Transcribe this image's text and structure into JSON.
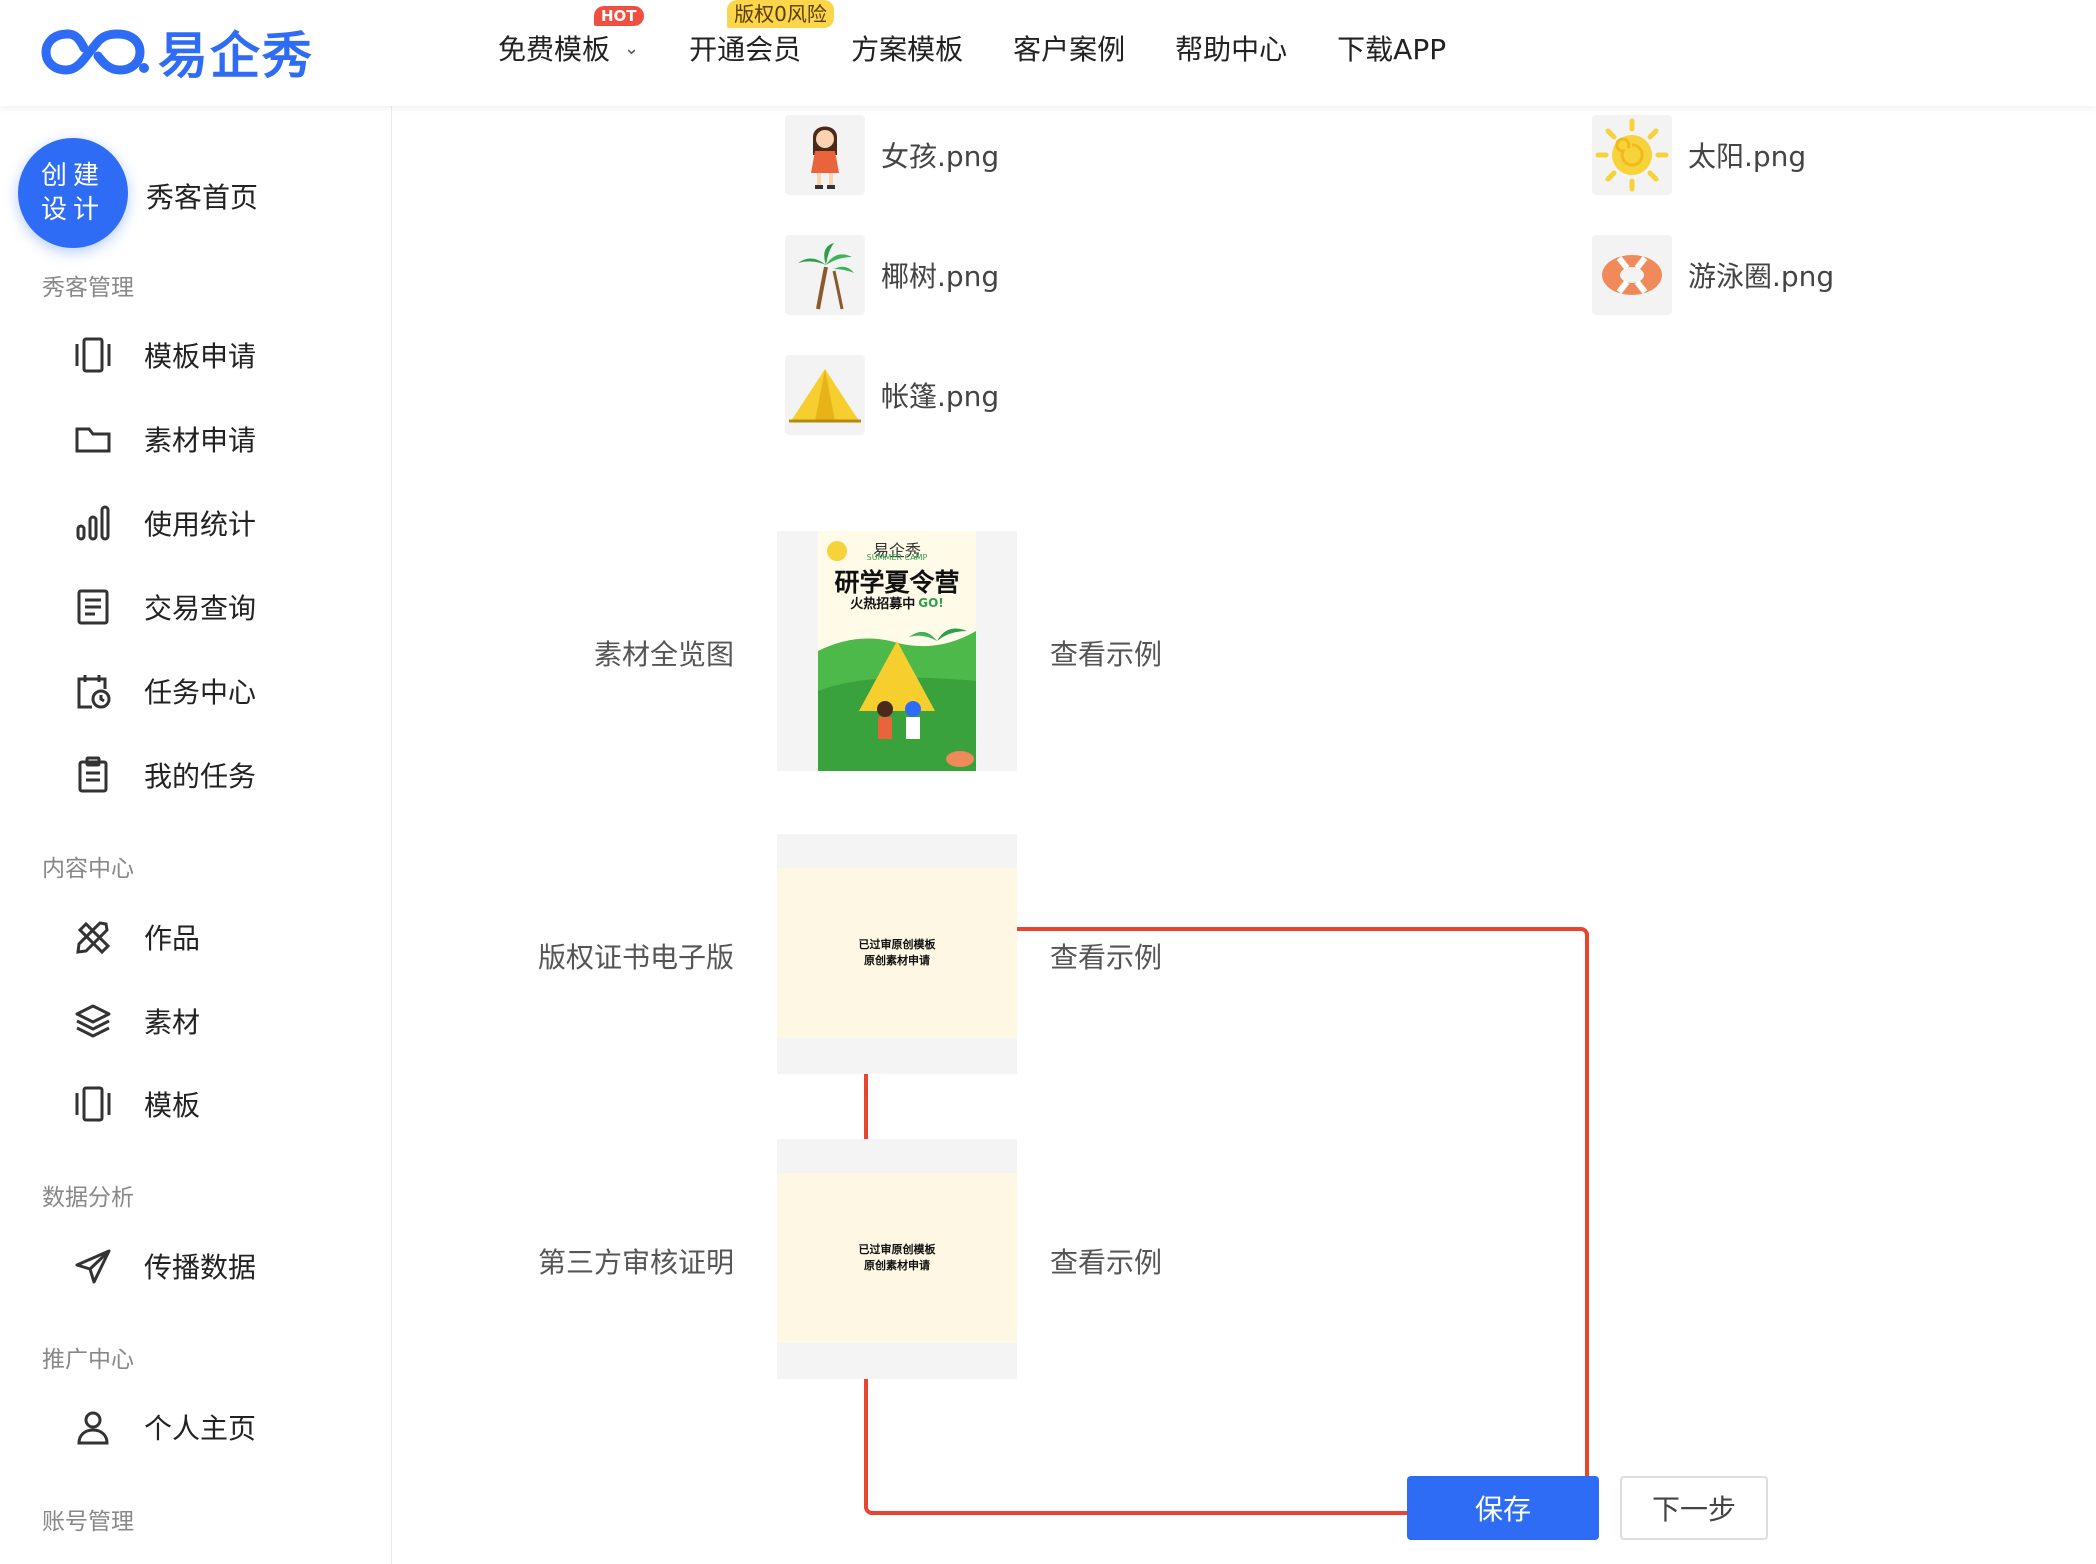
{
  "header": {
    "logo_text": "易企秀",
    "nav": [
      {
        "label": "免费模板",
        "badge": "HOT",
        "has_dropdown": true
      },
      {
        "label": "开通会员",
        "badge": "版权0风险"
      },
      {
        "label": "方案模板"
      },
      {
        "label": "客户案例"
      },
      {
        "label": "帮助中心"
      },
      {
        "label": "下载APP"
      }
    ]
  },
  "sidebar": {
    "create_button": "创建设计",
    "home": "秀客首页",
    "sections": [
      {
        "title": "秀客管理",
        "items": [
          {
            "label": "模板申请",
            "icon": "template-icon"
          },
          {
            "label": "素材申请",
            "icon": "folder-icon"
          },
          {
            "label": "使用统计",
            "icon": "bar-chart-icon"
          },
          {
            "label": "交易查询",
            "icon": "document-list-icon"
          },
          {
            "label": "任务中心",
            "icon": "calendar-clock-icon"
          },
          {
            "label": "我的任务",
            "icon": "clipboard-icon"
          }
        ]
      },
      {
        "title": "内容中心",
        "items": [
          {
            "label": "作品",
            "icon": "tools-icon"
          },
          {
            "label": "素材",
            "icon": "layers-icon"
          },
          {
            "label": "模板",
            "icon": "template-icon"
          }
        ]
      },
      {
        "title": "数据分析",
        "items": [
          {
            "label": "传播数据",
            "icon": "send-icon"
          }
        ]
      },
      {
        "title": "推广中心",
        "items": [
          {
            "label": "个人主页",
            "icon": "user-icon"
          }
        ]
      },
      {
        "title": "账号管理",
        "items": []
      }
    ]
  },
  "files": [
    {
      "name": "女孩.png",
      "icon": "girl-illustration"
    },
    {
      "name": "太阳.png",
      "icon": "sun-illustration"
    },
    {
      "name": "椰树.png",
      "icon": "palm-tree-illustration"
    },
    {
      "name": "游泳圈.png",
      "icon": "swim-ring-illustration"
    },
    {
      "name": "帐篷.png",
      "icon": "tent-illustration"
    }
  ],
  "rows": [
    {
      "label": "素材全览图",
      "link": "查看示例"
    },
    {
      "label": "版权证书电子版",
      "link": "查看示例",
      "preview_lines": [
        "已过审原创模板",
        "原创素材申请"
      ]
    },
    {
      "label": "第三方审核证明",
      "link": "查看示例",
      "preview_lines": [
        "已过审原创模板",
        "原创素材申请"
      ]
    }
  ],
  "poster": {
    "brand": "易企秀",
    "subtitle": "SUMMER CAMP",
    "title": "研学夏令营",
    "tagline": "火热招募中",
    "go": "GO!"
  },
  "buttons": {
    "save": "保存",
    "next": "下一步"
  },
  "colors": {
    "brand": "#2f6cf6",
    "highlight_frame": "#e8442f",
    "hot_badge": "#f04e3e",
    "risk_badge": "#fbd64a"
  }
}
